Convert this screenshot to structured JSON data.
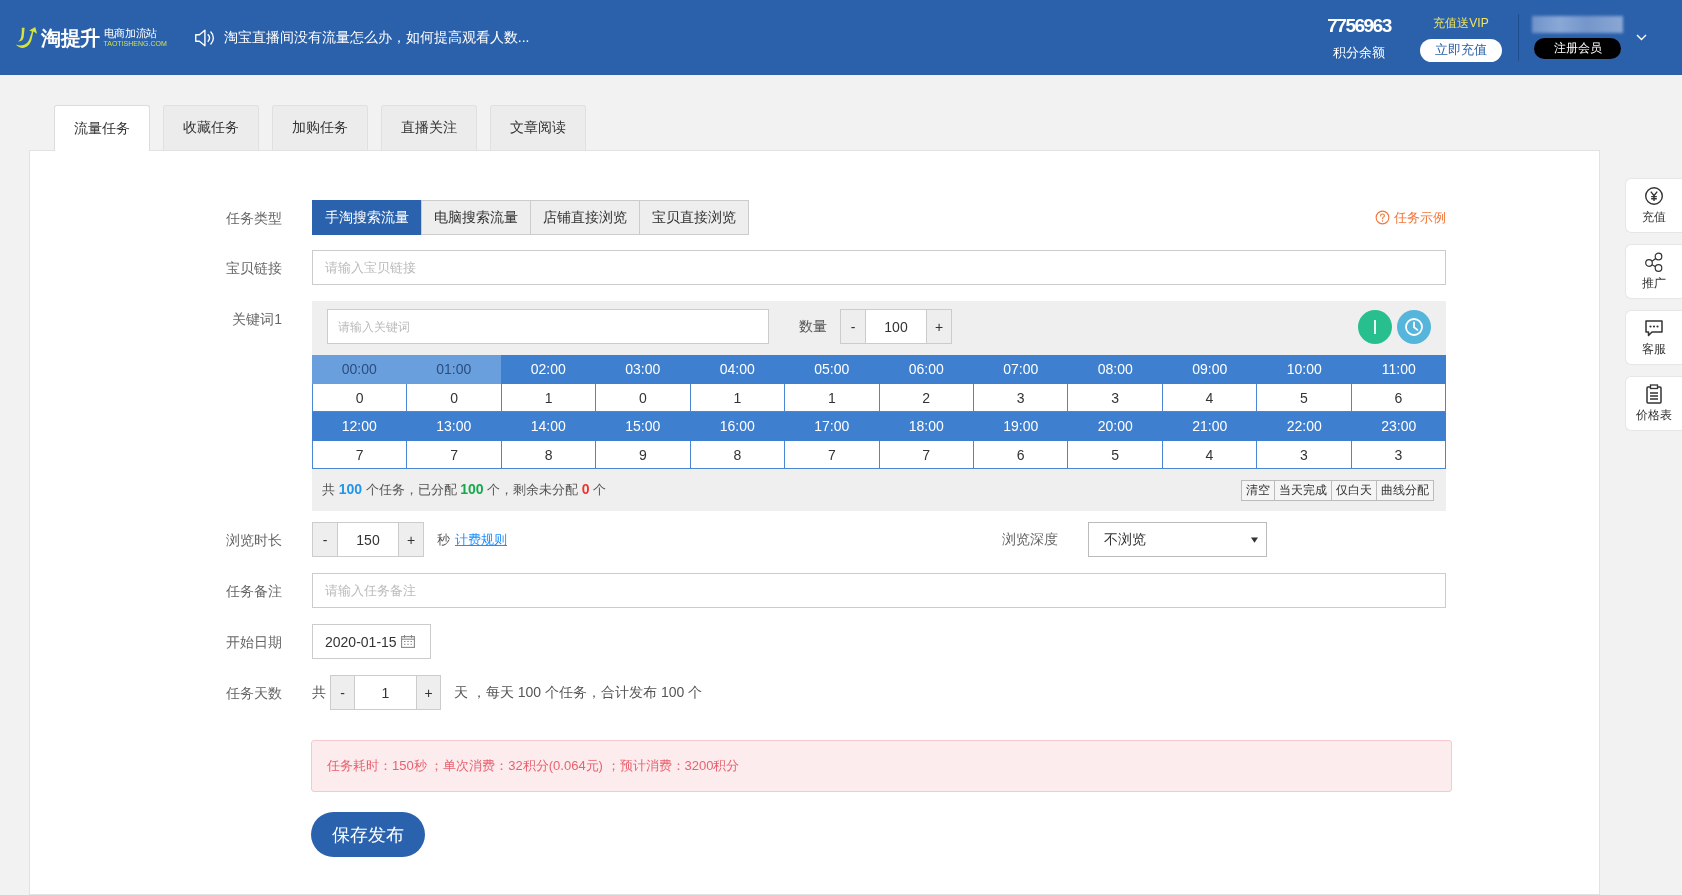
{
  "header": {
    "logo": {
      "name": "淘提升",
      "tagline": "电商加流站",
      "domain": "TAOTISHENG.COM"
    },
    "notice": "淘宝直播间没有流量怎么办，如何提高观看人数...",
    "balance": {
      "value": "7756963",
      "label": "积分余额"
    },
    "promo": "充值送VIP",
    "recharge_button": "立即充值",
    "register_button": "注册会员"
  },
  "tabs": [
    {
      "label": "流量任务",
      "selected": true
    },
    {
      "label": "收藏任务",
      "selected": false
    },
    {
      "label": "加购任务",
      "selected": false
    },
    {
      "label": "直播关注",
      "selected": false
    },
    {
      "label": "文章阅读",
      "selected": false
    }
  ],
  "form": {
    "task_type": {
      "label": "任务类型",
      "options": [
        {
          "label": "手淘搜索流量",
          "selected": true
        },
        {
          "label": "电脑搜索流量",
          "selected": false
        },
        {
          "label": "店铺直接浏览",
          "selected": false
        },
        {
          "label": "宝贝直接浏览",
          "selected": false
        }
      ]
    },
    "example_link": "任务示例",
    "item_link": {
      "label": "宝贝链接",
      "placeholder": "请输入宝贝链接"
    },
    "keyword": {
      "label": "关键词1",
      "placeholder": "请输入关键词",
      "quantity_label": "数量",
      "quantity": {
        "minus": "-",
        "value": "100",
        "plus": "+"
      }
    },
    "schedule": [
      {
        "hour": "00:00",
        "count": "0",
        "disabled": true
      },
      {
        "hour": "01:00",
        "count": "0",
        "disabled": true
      },
      {
        "hour": "02:00",
        "count": "1",
        "disabled": false
      },
      {
        "hour": "03:00",
        "count": "0",
        "disabled": false
      },
      {
        "hour": "04:00",
        "count": "1",
        "disabled": false
      },
      {
        "hour": "05:00",
        "count": "1",
        "disabled": false
      },
      {
        "hour": "06:00",
        "count": "2",
        "disabled": false
      },
      {
        "hour": "07:00",
        "count": "3",
        "disabled": false
      },
      {
        "hour": "08:00",
        "count": "3",
        "disabled": false
      },
      {
        "hour": "09:00",
        "count": "4",
        "disabled": false
      },
      {
        "hour": "10:00",
        "count": "5",
        "disabled": false
      },
      {
        "hour": "11:00",
        "count": "6",
        "disabled": false
      },
      {
        "hour": "12:00",
        "count": "7",
        "disabled": false
      },
      {
        "hour": "13:00",
        "count": "7",
        "disabled": false
      },
      {
        "hour": "14:00",
        "count": "8",
        "disabled": false
      },
      {
        "hour": "15:00",
        "count": "9",
        "disabled": false
      },
      {
        "hour": "16:00",
        "count": "8",
        "disabled": false
      },
      {
        "hour": "17:00",
        "count": "7",
        "disabled": false
      },
      {
        "hour": "18:00",
        "count": "7",
        "disabled": false
      },
      {
        "hour": "19:00",
        "count": "6",
        "disabled": false
      },
      {
        "hour": "20:00",
        "count": "5",
        "disabled": false
      },
      {
        "hour": "21:00",
        "count": "4",
        "disabled": false
      },
      {
        "hour": "22:00",
        "count": "3",
        "disabled": false
      },
      {
        "hour": "23:00",
        "count": "3",
        "disabled": false
      }
    ],
    "summary": [
      {
        "kind": "plain",
        "text": "共"
      },
      {
        "kind": "total",
        "text": "100"
      },
      {
        "kind": "plain",
        "text": "个任务，已分配"
      },
      {
        "kind": "assigned",
        "text": "100"
      },
      {
        "kind": "plain",
        "text": "个，剩余未分配"
      },
      {
        "kind": "remaining",
        "text": "0"
      },
      {
        "kind": "plain",
        "text": "个"
      }
    ],
    "distribution_buttons": [
      "清空",
      "当天完成",
      "仅白天",
      "曲线分配"
    ],
    "browse_time": {
      "label": "浏览时长",
      "stepper": {
        "minus": "-",
        "value": "150",
        "plus": "+"
      },
      "unit": "秒",
      "rule_link": "计费规则"
    },
    "browse_depth": {
      "label": "浏览深度",
      "value": "不浏览"
    },
    "remark": {
      "label": "任务备注",
      "placeholder": "请输入任务备注"
    },
    "start_date": {
      "label": "开始日期",
      "value": "2020-01-15"
    },
    "days": {
      "label": "任务天数",
      "prefix": "共",
      "stepper": {
        "minus": "-",
        "value": "1",
        "plus": "+"
      },
      "suffix": "天 ，每天 100 个任务，合计发布 100 个"
    },
    "cost_notice": "任务耗时：150秒 ；单次消费：32积分(0.064元) ；预计消费：3200积分",
    "submit_button": "保存发布"
  },
  "side_toolbar": [
    {
      "kind": "recharge",
      "label": "充值"
    },
    {
      "kind": "promote",
      "label": "推广"
    },
    {
      "kind": "service",
      "label": "客服"
    },
    {
      "kind": "prices",
      "label": "价格表"
    }
  ]
}
